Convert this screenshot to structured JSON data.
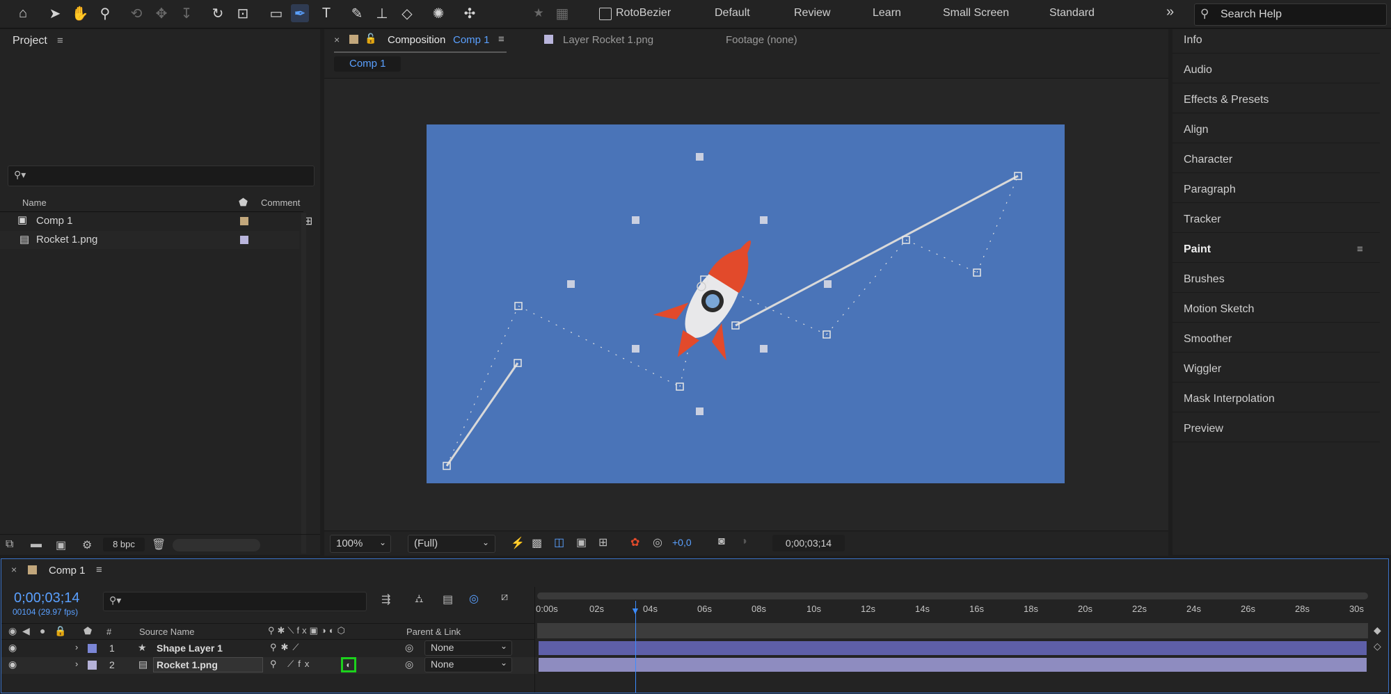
{
  "toolbar": {
    "tools": [
      {
        "name": "home-icon",
        "glyph": "⌂"
      },
      {
        "name": "selection-tool-icon",
        "glyph": "➤"
      },
      {
        "name": "hand-tool-icon",
        "glyph": "✋"
      },
      {
        "name": "zoom-tool-icon",
        "glyph": "⚲"
      },
      {
        "name": "orbit-camera-icon",
        "glyph": "⟲"
      },
      {
        "name": "pan-camera-icon",
        "glyph": "✥"
      },
      {
        "name": "dolly-camera-icon",
        "glyph": "↧"
      },
      {
        "name": "rotation-tool-icon",
        "glyph": "↻"
      },
      {
        "name": "pan-behind-tool-icon",
        "glyph": "⊡"
      },
      {
        "name": "rectangle-tool-icon",
        "glyph": "▭"
      },
      {
        "name": "pen-tool-icon",
        "glyph": "✒"
      },
      {
        "name": "type-tool-icon",
        "glyph": "T"
      },
      {
        "name": "brush-tool-icon",
        "glyph": "✎"
      },
      {
        "name": "clone-stamp-icon",
        "glyph": "⊥"
      },
      {
        "name": "eraser-tool-icon",
        "glyph": "◇"
      },
      {
        "name": "roto-brush-icon",
        "glyph": "✺"
      },
      {
        "name": "puppet-pin-icon",
        "glyph": "✣"
      }
    ],
    "rotobezier_label": "RotoBezier",
    "workspaces": [
      "Default",
      "Review",
      "Learn",
      "Small Screen",
      "Standard"
    ],
    "more": "»",
    "search_placeholder": "Search Help"
  },
  "project": {
    "title": "Project",
    "search_placeholder": "⚲▾",
    "columns": {
      "name": "Name",
      "comment": "Comment"
    },
    "items": [
      {
        "label": "Comp 1",
        "color": "#c2a77c"
      },
      {
        "label": "Rocket 1.png",
        "color": "#b9b5dc"
      }
    ],
    "bpc": "8 bpc"
  },
  "composition": {
    "tab_prefix": "Composition",
    "tab_name": "Comp 1",
    "layer_tab": "Layer Rocket 1.png",
    "footage_tab": "Footage (none)",
    "breadcrumb": "Comp 1",
    "canvas_color": "#4a74b8",
    "zoom": "100%",
    "resolution": "(Full)",
    "exposure": "+0,0",
    "timecode": "0;00;03;14"
  },
  "right_panel": {
    "items": [
      "Info",
      "Audio",
      "Effects & Presets",
      "Align",
      "Character",
      "Paragraph",
      "Tracker",
      "Paint",
      "Brushes",
      "Motion Sketch",
      "Smoother",
      "Wiggler",
      "Mask Interpolation",
      "Preview"
    ]
  },
  "timeline": {
    "tab": "Comp 1",
    "timecode": "0;00;03;14",
    "frame_info": "00104 (29.97 fps)",
    "search_placeholder": "⚲▾",
    "columns": {
      "num": "#",
      "source": "Source Name",
      "parent": "Parent & Link"
    },
    "ruler": [
      "0:00s",
      "02s",
      "04s",
      "06s",
      "08s",
      "10s",
      "12s",
      "14s",
      "16s",
      "18s",
      "20s",
      "22s",
      "24s",
      "26s",
      "28s",
      "30s"
    ],
    "layers": [
      {
        "num": "1",
        "name": "Shape Layer 1",
        "parent": "None",
        "color": "#7b86d6"
      },
      {
        "num": "2",
        "name": "Rocket 1.png",
        "parent": "None",
        "color": "#b5b2d8"
      }
    ],
    "current_time_fraction": 0.1161
  }
}
